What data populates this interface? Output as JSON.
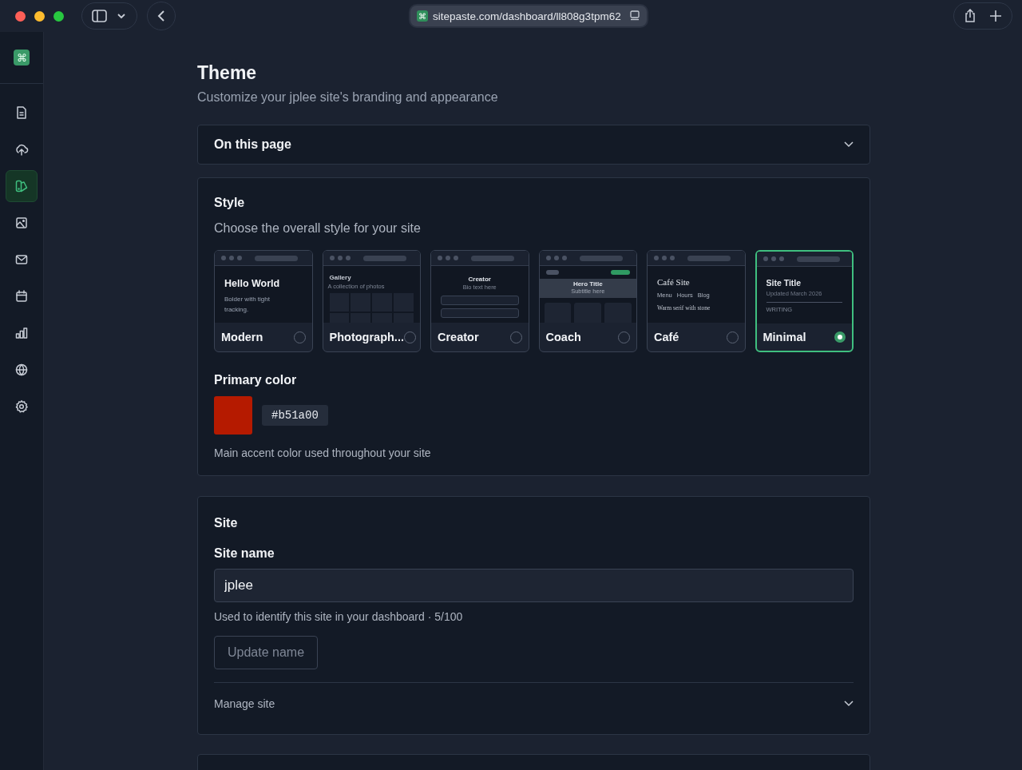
{
  "browser": {
    "url": "sitepaste.com/dashboard/ll808g3tpm62",
    "site_icon": "⌘"
  },
  "sidebar": {
    "logo": "⌘",
    "items": [
      {
        "selected": false
      },
      {
        "selected": false
      },
      {
        "selected": true
      },
      {
        "selected": false
      },
      {
        "selected": false
      },
      {
        "selected": false
      },
      {
        "selected": false
      },
      {
        "selected": false
      },
      {
        "selected": false
      }
    ]
  },
  "header": {
    "title": "Theme",
    "subtitle": "Customize your jplee site's branding and appearance"
  },
  "on_this_page": {
    "label": "On this page",
    "expanded": false
  },
  "style": {
    "title": "Style",
    "description": "Choose the overall style for your site",
    "options": [
      {
        "kind": "modern",
        "name": "Modern",
        "selected": false,
        "preview": {
          "title": "Hello World",
          "subtitle": "Bolder with tight tracking."
        }
      },
      {
        "kind": "gallery",
        "name": "Photograph...",
        "selected": false,
        "preview": {
          "title": "Gallery",
          "subtitle": "A collection of photos"
        }
      },
      {
        "kind": "creator",
        "name": "Creator",
        "selected": false,
        "preview": {
          "title": "Creator",
          "subtitle": "Bio text here"
        }
      },
      {
        "kind": "coach",
        "name": "Coach",
        "selected": false,
        "preview": {
          "title": "Hero Title",
          "subtitle": "Subtitle here"
        }
      },
      {
        "kind": "cafe",
        "name": "Café",
        "selected": false,
        "preview": {
          "title": "Café Site",
          "subtitle": "Warm serif with stone",
          "links": [
            "Menu",
            "Hours",
            "Blog"
          ]
        }
      },
      {
        "kind": "minimal",
        "name": "Minimal",
        "selected": true,
        "preview": {
          "title": "Site Title",
          "subtitle": "Updated March 2026",
          "section": "WRITING"
        }
      }
    ],
    "primary_color": {
      "label": "Primary color",
      "value": "#b51a00",
      "help": "Main accent color used throughout your site"
    }
  },
  "site": {
    "title": "Site",
    "field_label": "Site name",
    "value": "jplee",
    "help": "Used to identify this site in your dashboard · 5/100",
    "button": "Update name",
    "manage": {
      "label": "Manage site",
      "expanded": false
    }
  }
}
